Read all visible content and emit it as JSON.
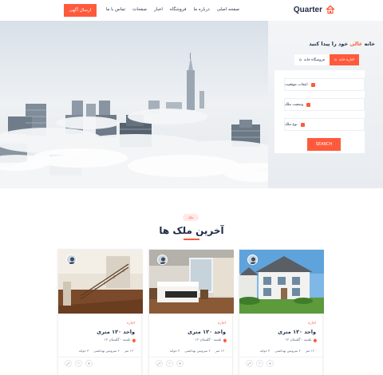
{
  "header": {
    "logo_text": "Quarter",
    "nav": [
      "صفحه اصلی",
      "درباره ما",
      "فروشگاه",
      "اخبار",
      "صفحات",
      "تماس با ما"
    ],
    "cta_label": "ارسال آگهی"
  },
  "search": {
    "title_prefix": "خانه ",
    "title_accent": "عالی",
    "title_suffix": " خود را پیدا کنید",
    "tabs": [
      "اجاره خانه",
      "فروشگاه خانه"
    ],
    "fields": [
      "انتخاب موقعیت",
      "وضعیت ملک",
      "نوع ملک"
    ],
    "button": "SEARCH"
  },
  "section": {
    "tag": "ملک",
    "title": "آخرین ملک ها"
  },
  "cards": [
    {
      "status": "اجاره",
      "title": "واحد ۱۲۰ متری",
      "location": "تلفنیه - گلستان ۱۲",
      "meta": [
        "۳ خوابه",
        "۲ سرویس بهداشتی",
        "۱۲۰ متر"
      ]
    },
    {
      "status": "اجاره",
      "title": "واحد ۱۲۰ متری",
      "location": "تلفنیه - گلستان ۱۲",
      "meta": [
        "۳ خوابه",
        "۲ سرویس بهداشتی",
        "۱۲۰ متر"
      ]
    },
    {
      "status": "اجاره",
      "title": "واحد ۱۲۰ متری",
      "location": "تلفنیه - گلستان ۱۲",
      "meta": [
        "۳ خوابه",
        "۲ سرویس بهداشتی",
        "۱۲۰ متر"
      ]
    }
  ],
  "icons": {
    "logo": "house-logo-icon",
    "tab_rent": "key-icon",
    "tab_sale": "house-icon",
    "field": "map-marker-icon",
    "actions": [
      "expand-icon",
      "heart-icon",
      "plus-icon"
    ]
  },
  "colors": {
    "accent": "#ff5a3c",
    "dark": "#1f2a44"
  }
}
